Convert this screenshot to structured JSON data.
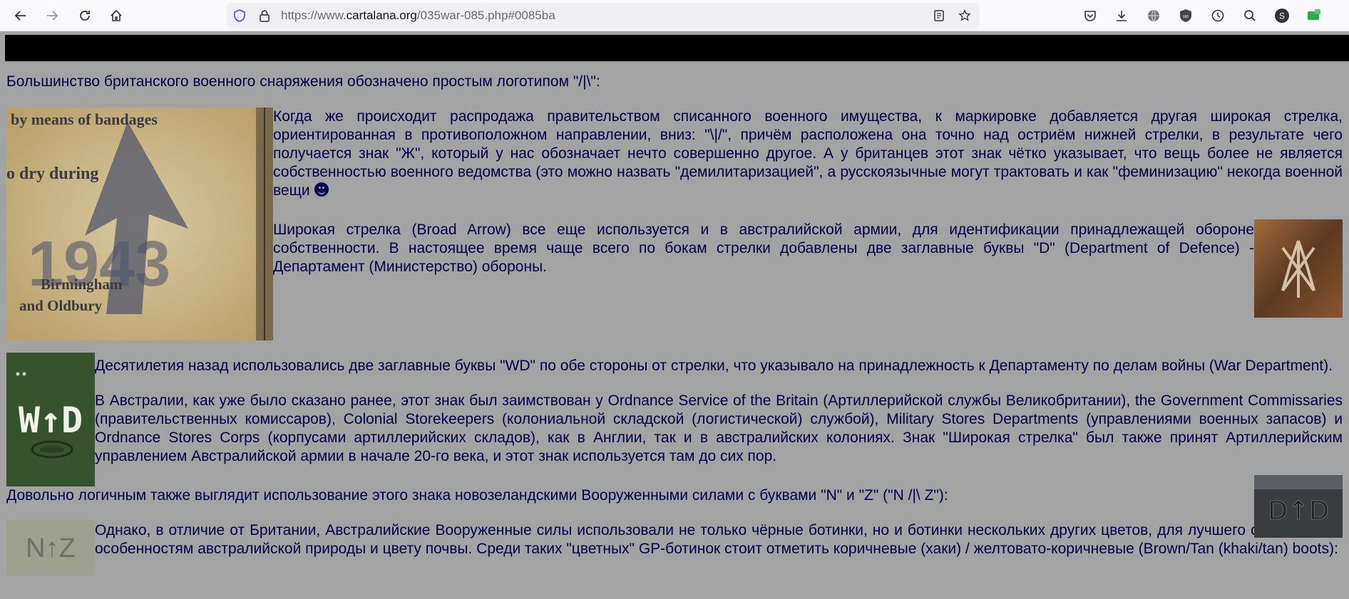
{
  "browser": {
    "url_prefix": "https://www.",
    "url_domain": "cartalana.org",
    "url_path": "/035war-085.php#0085ba",
    "nav_icons": [
      "back-arrow-icon",
      "forward-arrow-icon",
      "reload-icon",
      "home-icon"
    ],
    "right_icons": [
      "pocket-icon",
      "download-icon",
      "translate-icon",
      "shield-extension-icon",
      "history-icon",
      "search-icon",
      "account-icon",
      "extension-icon"
    ]
  },
  "content": {
    "p1": "Большинство британского военного снаряжения обозначено простым логотипом \"/|\\\":",
    "p2": "Когда же происходит распродажа правительством списанного военного имущества, к маркировке добавляется другая широкая стрелка, ориентированная в противоположном направлении, вниз: \"\\|/\", причём расположена она точно над остриём нижней стрелки, в результате чего получается знак \"Ж\", который у нас обозначает нечто совершенно другое. А у британцев этот знак чётко указывает, что вещь более не является собственностью военного ведомства (это можно назвать \"демилитаризацией\", а русскоязычные могут трактовать и как \"феминизацию\" некогда военной вещи",
    "p3": "Широкая стрелка (Broad Arrow) все еще используется и в австралийской армии, для идентификации принадлежащей обороне собственности. В настоящее время чаще всего по бокам стрелки добавлены две заглавные буквы \"D\" (Department of Defence) - Департамент (Министерство) обороны.",
    "p4": "Десятилетия назад использовались две заглавные буквы \"WD\" по обе стороны от стрелки, что указывало на принадлежность к Департаменту по делам войны (War Department).",
    "p5": "В Австралии, как уже было сказано ранее, этот знак был заимствован у Ordnance Service of the Britain (Артиллерийской службы Великобритании), the Government Commissaries (правительственных комиссаров), Colonial Storekeepers (колониальной складской (логистической) службой), Military Stores Departments (управлениями военных запасов) и Ordnance Stores Corps (корпусами артиллерийских складов), как в Англии, так и в австралийских колониях. Знак \"Широкая стрелка\" был также принят Артиллерийским управлением Австралийской армии в начале 20-го века, и этот знак используется там до сих пор.",
    "p6": "Довольно логичным также выглядит использование этого знака новозеландскими Вооруженными силами с буквами \"N\" и \"Z\" (\"N /|\\ Z\"):",
    "p7": "Однако, в отличие от Британии, Австралийские Вооруженные силы использовали не только чёрные ботинки, но и ботинки нескольких других цветов, для лучшего соответствия особенностям австралийской природы и цвету почвы. Среди таких \"цветных\" GP-ботинок стоит отметить коричневые (хаки) / желтовато-коричневые (Brown/Tan (khaki/tan) boots):"
  },
  "images": {
    "stamp": {
      "line1": "by means of bandages",
      "line2": "o dry during",
      "year": "1943",
      "line3": "Birmingham",
      "line4": "and Oldbury"
    },
    "wd": {
      "text": "W↑D"
    },
    "nz": {
      "text": "N↑Z"
    },
    "dd": {
      "text": "D↑D"
    }
  }
}
